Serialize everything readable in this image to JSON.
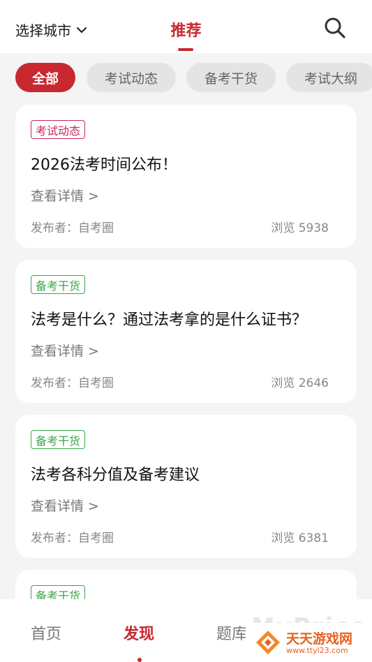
{
  "header": {
    "city_label": "选择城市",
    "title": "推荐"
  },
  "colors": {
    "accent": "#c8282f",
    "tag_red": "#c8285c",
    "tag_green": "#3aa64a"
  },
  "chips": [
    {
      "label": "全部",
      "active": true
    },
    {
      "label": "考试动态",
      "active": false
    },
    {
      "label": "备考干货",
      "active": false
    },
    {
      "label": "考试大纲",
      "active": false
    }
  ],
  "cards": [
    {
      "tag": "考试动态",
      "title": "2026法考时间公布！",
      "detail": "查看详情 >",
      "publisher": "发布者：自考圈",
      "views": "浏览 5938"
    },
    {
      "tag": "备考干货",
      "title": "法考是什么？通过法考拿的是什么证书？",
      "detail": "查看详情 >",
      "publisher": "发布者：自考圈",
      "views": "浏览 2646"
    },
    {
      "tag": "备考干货",
      "title": "法考各科分值及备考建议",
      "detail": "查看详情 >",
      "publisher": "发布者：自考圈",
      "views": "浏览 6381"
    },
    {
      "tag": "备考干货"
    }
  ],
  "bottom_nav": {
    "items": [
      {
        "label": "首页",
        "active": false
      },
      {
        "label": "发现",
        "active": true
      },
      {
        "label": "题库",
        "active": false
      }
    ]
  },
  "watermark": {
    "overlay_text": "MyPrice",
    "brand": "天天游戏网",
    "url": "www.ttyl23.com"
  }
}
